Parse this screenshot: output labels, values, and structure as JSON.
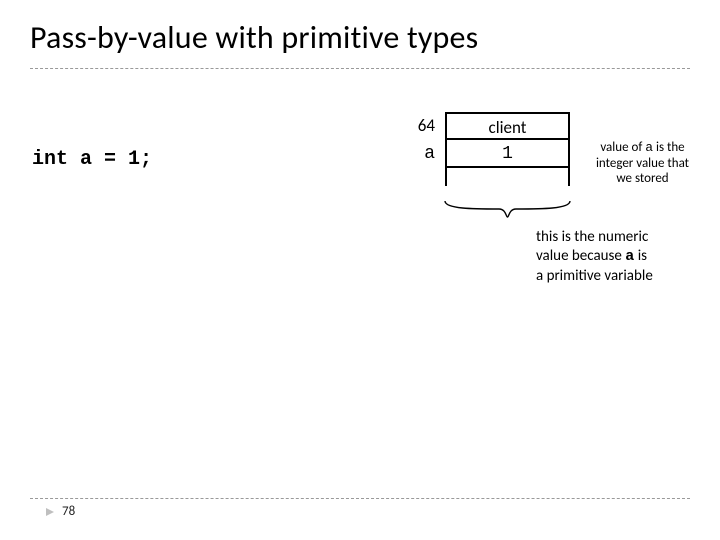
{
  "title": "Pass-by-value with primitive types",
  "code": "int a = 1;",
  "memory": {
    "addr_label": "64",
    "header": "client",
    "var_label": "a",
    "var_value": "1"
  },
  "right_note": {
    "line1": "value of ",
    "var": "a",
    "line1b": " is the",
    "line2": "integer value that",
    "line3": "we stored"
  },
  "below_note": {
    "line1": "this is the numeric",
    "line2a": "value because ",
    "mono": "a",
    "line2b": "  is",
    "line3": "a primitive variable"
  },
  "page_number": "78"
}
